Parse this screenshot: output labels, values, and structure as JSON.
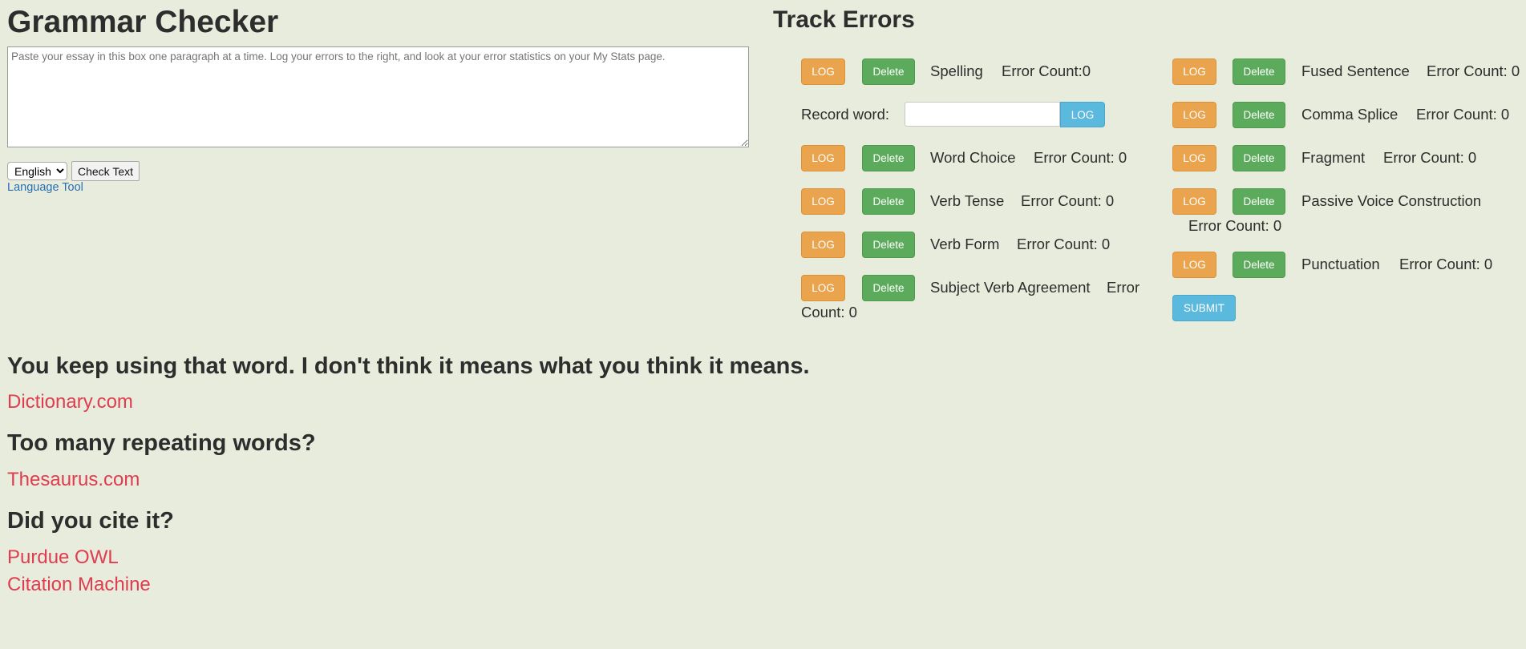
{
  "page": {
    "title": "Grammar Checker",
    "essay_placeholder": "Paste your essay in this box one paragraph at a time. Log your errors to the right, and look at your error statistics on your My Stats page.",
    "language_selected": "English",
    "check_button": "Check Text",
    "language_tool_link": "Language Tool"
  },
  "track": {
    "title": "Track Errors",
    "log_label": "LOG",
    "delete_label": "Delete",
    "submit_label": "SUBMIT",
    "record_word_label": "Record word:",
    "left": [
      {
        "name": "Spelling",
        "count": "Error Count:0"
      },
      {
        "name": "Word Choice",
        "count": "Error Count: 0"
      },
      {
        "name": "Verb Tense",
        "count": "Error Count: 0"
      },
      {
        "name": "Verb Form",
        "count": "Error Count: 0"
      },
      {
        "name": "Subject Verb Agreement",
        "count_part1": "Error",
        "count_part2": "Count: 0"
      }
    ],
    "right": [
      {
        "name": "Fused Sentence",
        "count": "Error Count: 0"
      },
      {
        "name": "Comma Splice",
        "count": "Error Count: 0"
      },
      {
        "name": "Fragment",
        "count": "Error Count: 0"
      },
      {
        "name": "Passive Voice Construction",
        "count": "Error Count: 0"
      },
      {
        "name": "Punctuation",
        "count": "Error Count: 0"
      }
    ]
  },
  "resources": {
    "heading1": "You keep using that word. I don't think it means what you think it means.",
    "link1": "Dictionary.com",
    "heading2": "Too many repeating words?",
    "link2": "Thesaurus.com",
    "heading3": "Did you cite it?",
    "link3": "Purdue OWL",
    "link4": "Citation Machine"
  },
  "colors": {
    "background": "#e8ecdc",
    "log_button": "#eba44e",
    "delete_button": "#5cab5c",
    "blue_button": "#5bb9dd",
    "link_red": "#e03c4f",
    "link_blue": "#2a6fb6"
  }
}
